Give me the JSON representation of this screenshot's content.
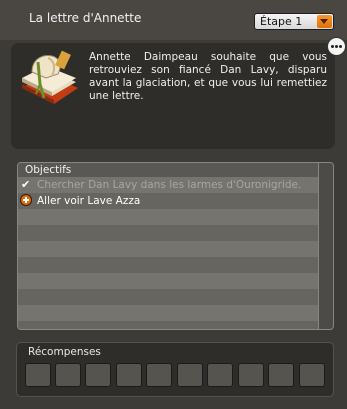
{
  "window": {
    "title": "La lettre d'Annette"
  },
  "step_select": {
    "value": "Étape 1"
  },
  "description": {
    "text": "Annette Daimpeau souhaite que vous retrouviez son fiancé Dan Lavy, disparu avant la glaciation, et que vous lui remettiez une lettre."
  },
  "objectives": {
    "title": "Objectifs",
    "items": [
      {
        "label": "Chercher Dan Lavy dans les larmes d'Ouronigride.",
        "status": "done"
      },
      {
        "label": "Aller voir Lave Azza",
        "status": "active"
      }
    ]
  },
  "rewards": {
    "title": "Récompenses",
    "slot_count": 10
  },
  "icons": {
    "quest_item": "book-scroll-icon",
    "more": "ellipsis-icon",
    "dropdown": "chevron-down-icon",
    "done": "check-icon",
    "active": "plus-circle-icon"
  },
  "colors": {
    "accent": "#e06f0b",
    "done_text": "#a8a6a1"
  }
}
